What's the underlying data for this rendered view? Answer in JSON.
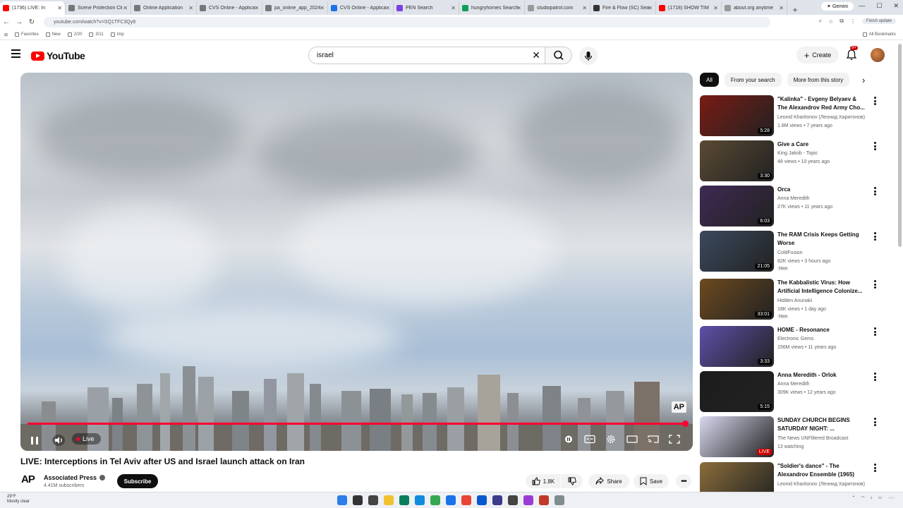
{
  "browser": {
    "tabs": [
      {
        "label": "(1736) LIVE: In",
        "color": "#ff0000",
        "active": true
      },
      {
        "label": "Scene Protection Cli",
        "color": "#777777"
      },
      {
        "label": "Online Application",
        "color": "#777777"
      },
      {
        "label": "CVS Online - Applica",
        "color": "#777777"
      },
      {
        "label": "pa_online_app_2024",
        "color": "#777777"
      },
      {
        "label": "CVS Online - Applica",
        "color": "#1a73e8"
      },
      {
        "label": "PEN Search",
        "color": "#7b3fe4"
      },
      {
        "label": "hungryhomes Search",
        "color": "#0f9d58"
      },
      {
        "label": "studiopatrol.com",
        "color": "#999999"
      },
      {
        "label": "Fire & Flow (SC) Sea",
        "color": "#333333"
      },
      {
        "label": "(1718) SHOW TIM",
        "color": "#ff0000"
      },
      {
        "label": "about.org anytime",
        "color": "#999999"
      }
    ],
    "gemini_label": "Gemini",
    "url": "youtube.com/watch?v=SQ1TFC3Qy8",
    "profile_label": "Finish update",
    "bookmarks": [
      "Favorites",
      "New",
      "2/20",
      "3/11",
      "Imp"
    ],
    "all_bookmarks": "All Bookmarks"
  },
  "masthead": {
    "logo_text": "YouTube",
    "search_value": "israel",
    "create_label": "Create",
    "notification_count": "9+"
  },
  "player": {
    "live_label": "Live",
    "bug_text": "AP",
    "title": "LIVE: Interceptions in Tel Aviv after US and Israel launch attack on Iran",
    "channel_name": "Associated Press",
    "channel_logo": "AP",
    "subscribers": "4.41M subscribers",
    "subscribe_label": "Subscribe",
    "like_count": "1.8K",
    "share_label": "Share",
    "save_label": "Save"
  },
  "sidebar": {
    "chips": [
      "All",
      "From your search",
      "More from this story"
    ],
    "recommendations": [
      {
        "title": "\"Kalinka\" - Evgeny Belyaev & The Alexandrov Red Army Cho...",
        "channel": "Leonid Kharitonov (Леонид Харитонов)",
        "meta": "1.8M views • 7 years ago",
        "duration": "5:28",
        "badge": "",
        "thumb": "#7a1b14"
      },
      {
        "title": "Give a Care",
        "channel": "King Jakob - Topic",
        "meta": "48 views • 10 years ago",
        "duration": "3:30",
        "badge": "",
        "thumb": "#5a4a33"
      },
      {
        "title": "Orca",
        "channel": "Anna Meredith",
        "meta": "27K views • 11 years ago",
        "duration": "6:03",
        "badge": "",
        "thumb": "#3f2a55"
      },
      {
        "title": "The RAM Crisis Keeps Getting Worse",
        "channel": "ColdFusion",
        "meta": "82K views • 3 hours ago",
        "duration": "21:05",
        "badge": "New",
        "thumb": "#3b4a5e"
      },
      {
        "title": "The Kabbalistic Virus: How Artificial Intelligence Colonize...",
        "channel": "Hidden Anunaki",
        "meta": "18K views • 1 day ago",
        "duration": "33:01",
        "badge": "New",
        "thumb": "#6d4a1f"
      },
      {
        "title": "HOME - Resonance",
        "channel": "Electronic Gems",
        "meta": "156M views • 11 years ago",
        "duration": "3:33",
        "badge": "",
        "thumb": "#5e4fa8"
      },
      {
        "title": "Anna Meredith - Orlok",
        "channel": "Anna Meredith",
        "meta": "309K views • 12 years ago",
        "duration": "5:15",
        "badge": "",
        "thumb": "#1c1c1c"
      },
      {
        "title": "SUNDAY CHURCH BEGINS SATURDAY NIGHT: ...",
        "channel": "The News UNFiltered Broadcast",
        "meta": "13 watching",
        "duration": "LIVE",
        "badge": "",
        "thumb": "#d9d9f0"
      },
      {
        "title": "\"Soldier's dance\" - The Alexandrov Ensemble (1965)",
        "channel": "Leonid Kharitonov (Леонид Харитонов)",
        "meta": "",
        "duration": "",
        "badge": "",
        "thumb": "#8a6d3b"
      }
    ]
  },
  "taskbar": {
    "weather_temp": "29°F",
    "weather_desc": "Mostly clear"
  },
  "colors": {
    "accent": "#ff0033",
    "brand": "#ff0000"
  }
}
